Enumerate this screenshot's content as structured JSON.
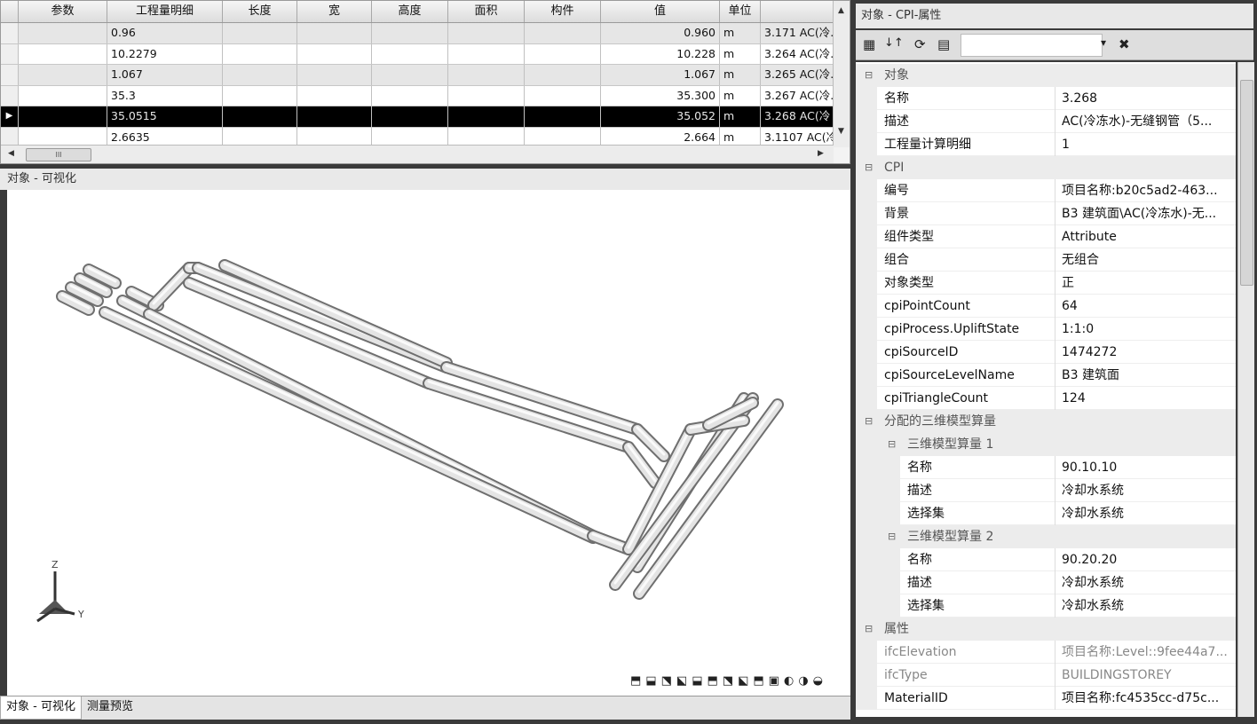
{
  "grid": {
    "columns": [
      "",
      "参数",
      "工程量明细",
      "长度",
      "宽",
      "高度",
      "面积",
      "构件",
      "值",
      "单位",
      ""
    ],
    "rows": [
      {
        "detail": "0.96",
        "value": "0.960",
        "unit": "m",
        "extra": "3.171 AC(冷."
      },
      {
        "detail": "10.2279",
        "value": "10.228",
        "unit": "m",
        "extra": "3.264 AC(冷."
      },
      {
        "detail": "1.067",
        "value": "1.067",
        "unit": "m",
        "extra": "3.265 AC(冷."
      },
      {
        "detail": "35.3",
        "value": "35.300",
        "unit": "m",
        "extra": "3.267 AC(冷."
      },
      {
        "detail": "35.0515",
        "value": "35.052",
        "unit": "m",
        "extra": "3.268 AC(冷",
        "selected": true
      },
      {
        "detail": "2.6635",
        "value": "2.664",
        "unit": "m",
        "extra": "3.1107 AC(冷"
      }
    ],
    "selected_marker": "▶",
    "hscroll_label": "III"
  },
  "visualization": {
    "title": "对象 - 可视化",
    "axis_z": "Z",
    "axis_y": "Y",
    "tools": [
      "⬒",
      "⬓",
      "⬔",
      "⬕",
      "⬓",
      "⬒",
      "⬔",
      "⬕",
      "⬒",
      "▣",
      "◐",
      "◑",
      "◒"
    ]
  },
  "bottom_tabs": [
    "对象 - 可视化",
    "测量预览"
  ],
  "properties": {
    "title": "对象 - CPI-属性",
    "toolbar": {
      "sort_cat": "▦",
      "sort_az": "↓↑",
      "refresh": "⟳",
      "pages": "▤",
      "dropdown": "▾",
      "close": "✖"
    },
    "groups": [
      {
        "name": "对象",
        "props": [
          {
            "k": "名称",
            "v": "3.268"
          },
          {
            "k": "描述",
            "v": "AC(冷冻水)-无缝钢管（5..."
          },
          {
            "k": "工程量计算明细",
            "v": "1"
          }
        ]
      },
      {
        "name": "CPI",
        "props": [
          {
            "k": "编号",
            "v": "项目名称:b20c5ad2-463..."
          },
          {
            "k": "背景",
            "v": "B3 建筑面\\AC(冷冻水)-无..."
          },
          {
            "k": "组件类型",
            "v": "Attribute"
          },
          {
            "k": "组合",
            "v": "无组合"
          },
          {
            "k": "对象类型",
            "v": "正"
          },
          {
            "k": "cpiPointCount",
            "v": "64"
          },
          {
            "k": "cpiProcess.UpliftState",
            "v": "1:1:0"
          },
          {
            "k": "cpiSourceID",
            "v": "1474272"
          },
          {
            "k": "cpiSourceLevelName",
            "v": "B3 建筑面"
          },
          {
            "k": "cpiTriangleCount",
            "v": "124"
          }
        ]
      },
      {
        "name": "分配的三维模型算量",
        "subgroups": [
          {
            "name": "三维模型算量 1",
            "props": [
              {
                "k": "名称",
                "v": "90.10.10"
              },
              {
                "k": "描述",
                "v": "冷却水系统"
              },
              {
                "k": "选择集",
                "v": "冷却水系统"
              }
            ]
          },
          {
            "name": "三维模型算量 2",
            "props": [
              {
                "k": "名称",
                "v": "90.20.20"
              },
              {
                "k": "描述",
                "v": "冷却水系统"
              },
              {
                "k": "选择集",
                "v": "冷却水系统"
              }
            ]
          }
        ]
      },
      {
        "name": "属性",
        "props": [
          {
            "k": "ifcElevation",
            "v": "项目名称:Level::9fee44a7...",
            "grey": true
          },
          {
            "k": "ifcType",
            "v": "BUILDINGSTOREY",
            "grey": true
          },
          {
            "k": "MaterialID",
            "v": "项目名称:fc4535cc-d75c..."
          }
        ]
      }
    ],
    "toggle_symbol": "⊟"
  }
}
